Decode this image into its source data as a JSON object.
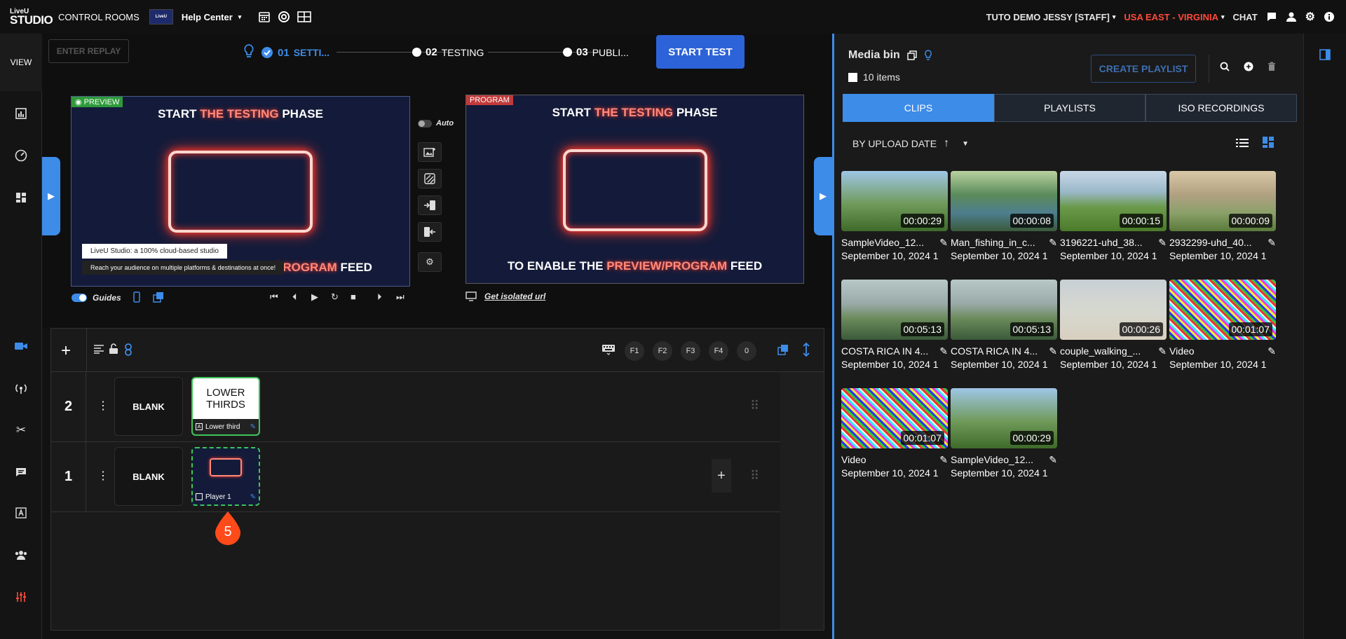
{
  "topbar": {
    "logo_top": "LiveU",
    "logo_bottom": "STUDIO",
    "control_rooms": "CONTROL ROOMS",
    "help_center": "Help Center",
    "user": "TUTO DEMO JESSY [STAFF]",
    "region": "USA EAST - VIRGINIA",
    "chat": "CHAT",
    "colors": {
      "region": "#ff4a3a",
      "accent": "#3d8ce8"
    }
  },
  "sidebar": {
    "view_label": "VIEW"
  },
  "stage": {
    "enter_replay": "ENTER REPLAY",
    "start_test": "START TEST",
    "steps": [
      {
        "num": "01",
        "label": "SETTI..."
      },
      {
        "num": "02",
        "label": "TESTING"
      },
      {
        "num": "03",
        "label": "PUBLI..."
      }
    ],
    "preview": {
      "tag": "PREVIEW",
      "title_pre": "START ",
      "title_hl": "THE TESTING",
      "title_post": " PHASE",
      "bottom_hl": "PROGRAM",
      "bottom_post": " FEED",
      "lt_line1": "LiveU Studio: a 100% cloud-based studio",
      "lt_line2": "Reach your audience on multiple platforms & destinations at once!"
    },
    "program": {
      "tag": "PROGRAM",
      "title_pre": "START ",
      "title_hl": "THE TESTING",
      "title_post": " PHASE",
      "bottom_pre": "TO ENABLE THE ",
      "bottom_hl": "PREVIEW/PROGRAM",
      "bottom_post": " FEED"
    },
    "auto_label": "Auto",
    "guides_label": "Guides",
    "isolated_url": "Get isolated url"
  },
  "timeline": {
    "fkeys": [
      "F1",
      "F2",
      "F3",
      "F4",
      "0"
    ],
    "rows": [
      {
        "num": "2",
        "blank": "BLANK",
        "card_title": "LOWER THIRDS",
        "card_label": "Lower third"
      },
      {
        "num": "1",
        "blank": "BLANK",
        "card_label": "Player 1"
      }
    ],
    "marker_number": "5"
  },
  "media_bin": {
    "title": "Media bin",
    "items_count": "10 items",
    "create_playlist": "CREATE PLAYLIST",
    "tabs": [
      "CLIPS",
      "PLAYLISTS",
      "ISO RECORDINGS"
    ],
    "sort_label": "BY UPLOAD DATE",
    "clips": [
      {
        "name": "SampleVideo_12...",
        "date": "September 10, 2024 1",
        "duration": "00:00:29",
        "kind": "bunny"
      },
      {
        "name": "Man_fishing_in_c...",
        "date": "September 10, 2024 1",
        "duration": "00:00:08",
        "kind": "river"
      },
      {
        "name": "3196221-uhd_38...",
        "date": "September 10, 2024 1",
        "duration": "00:00:15",
        "kind": "field"
      },
      {
        "name": "2932299-uhd_40...",
        "date": "September 10, 2024 1",
        "duration": "00:00:09",
        "kind": "net"
      },
      {
        "name": "COSTA RICA IN 4...",
        "date": "September 10, 2024 1",
        "duration": "00:05:13",
        "kind": "coast"
      },
      {
        "name": "COSTA RICA IN 4...",
        "date": "September 10, 2024 1",
        "duration": "00:05:13",
        "kind": "coast"
      },
      {
        "name": "couple_walking_...",
        "date": "September 10, 2024 1",
        "duration": "00:00:26",
        "kind": "beach"
      },
      {
        "name": "Video",
        "date": "September 10, 2024 1",
        "duration": "00:01:07",
        "kind": "noise"
      },
      {
        "name": "Video",
        "date": "September 10, 2024 1",
        "duration": "00:01:07",
        "kind": "noise"
      },
      {
        "name": "SampleVideo_12...",
        "date": "September 10, 2024 1",
        "duration": "00:00:29",
        "kind": "bunny"
      }
    ]
  }
}
